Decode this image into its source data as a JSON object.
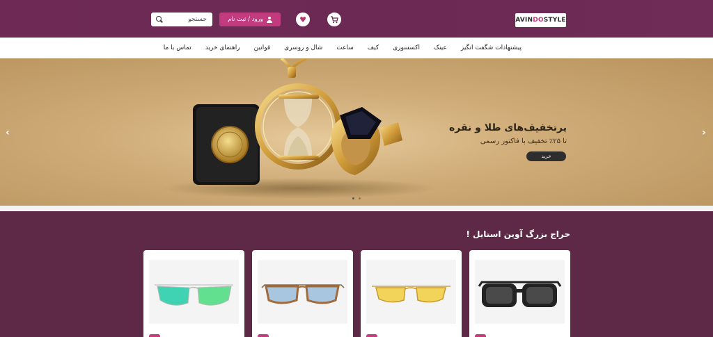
{
  "header": {
    "search_placeholder": "جستجو",
    "login_label": "ورود / ثبت نام",
    "cart_count": "0",
    "logo": {
      "part1": "AVIN",
      "part2": "DO",
      "part3": "STYLE"
    }
  },
  "nav": {
    "items": [
      "پیشنهادات شگفت انگیز",
      "عینک",
      "اکسسوری",
      "کیف",
      "ساعت",
      "شال و روسری",
      "قوانین",
      "راهنمای خرید",
      "تماس با ما"
    ]
  },
  "hero": {
    "title": "پرتخفیف‌های طلا و نقره",
    "subtitle": "تا ۲۵٪ تخفیف با فاکتور رسمی",
    "button": "خرید",
    "prev_arrow": "‹",
    "next_arrow": "›",
    "slide_count": 2,
    "active_slide": 1
  },
  "sale": {
    "title": "حراج بزرگ آوین استایل !",
    "products": [
      {
        "icon": "black-sunglasses-icon",
        "lens_color": "#4a4a4a"
      },
      {
        "icon": "yellow-glasses-icon",
        "lens_color": "#f3d45a"
      },
      {
        "icon": "blue-tinted-glasses-icon",
        "lens_color": "#a8c6df"
      },
      {
        "icon": "mirror-sunglasses-icon",
        "lens_color": "#48d6b8"
      }
    ]
  },
  "colors": {
    "brand": "#6b2953",
    "accent": "#c23b7f",
    "sale_bg": "#5e2847"
  }
}
